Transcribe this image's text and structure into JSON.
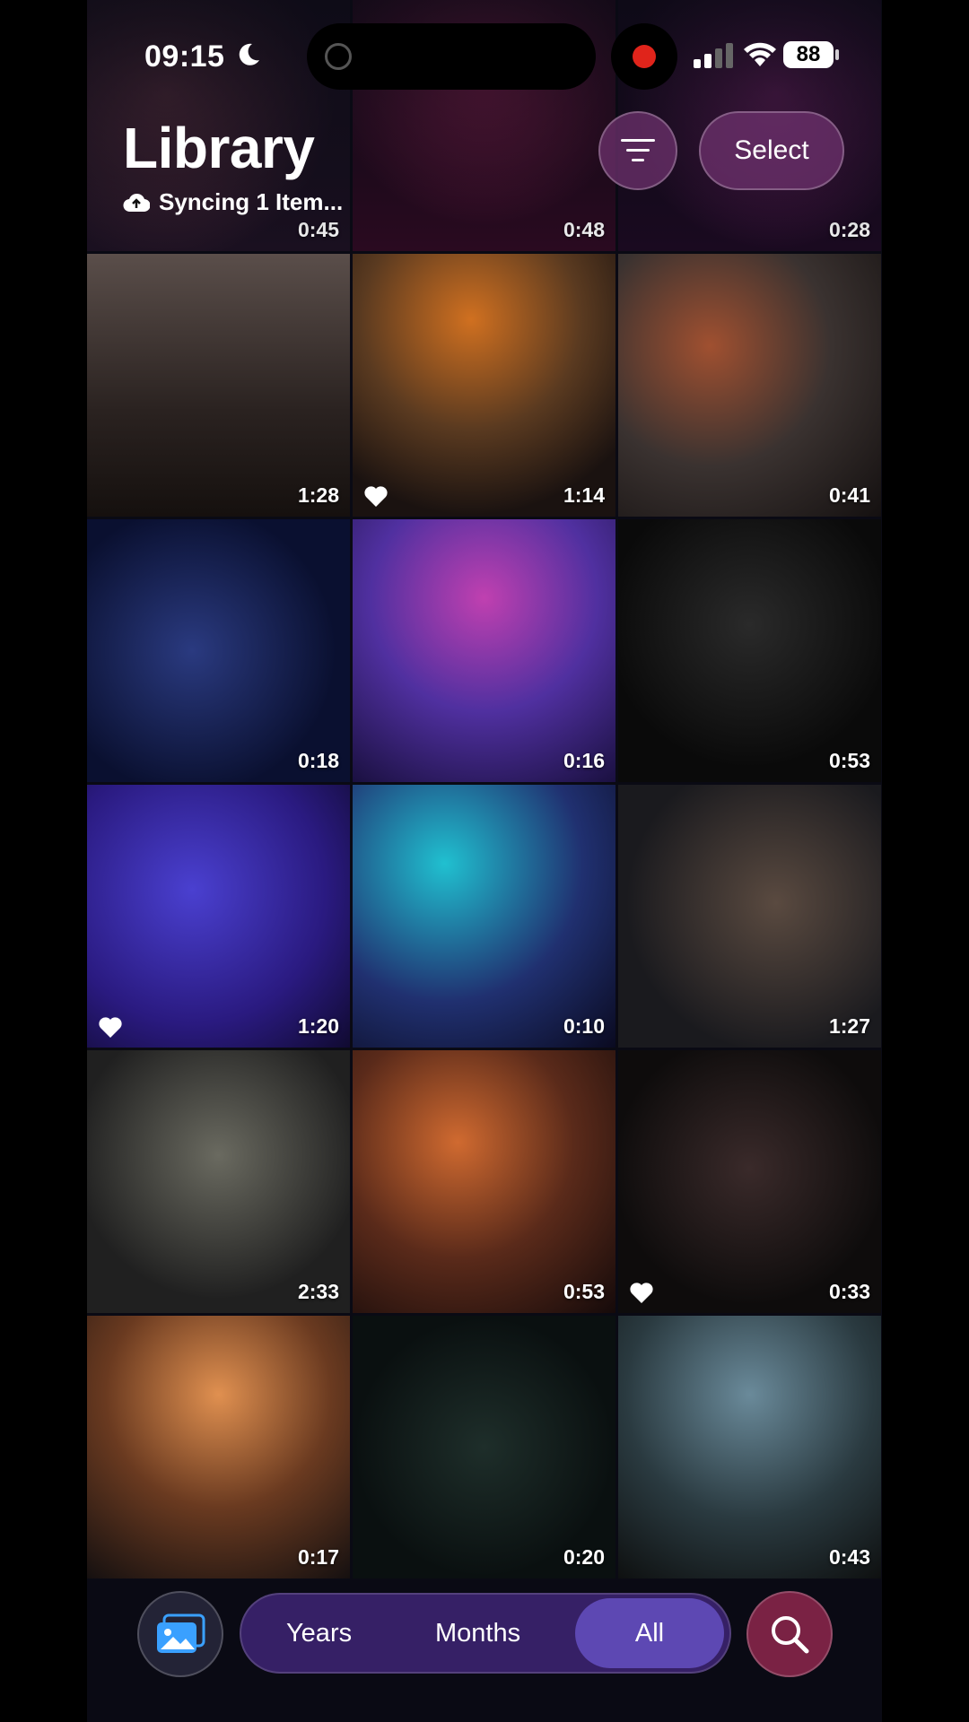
{
  "status_bar": {
    "time": "09:15",
    "battery": "88"
  },
  "header": {
    "title": "Library",
    "sync_status": "Syncing 1 Item...",
    "filter_icon": "filter-lines-icon",
    "select_label": "Select"
  },
  "grid": {
    "rows": [
      [
        {
          "duration": "0:45",
          "favorite": false
        },
        {
          "duration": "0:48",
          "favorite": false
        },
        {
          "duration": "0:28",
          "favorite": false
        }
      ],
      [
        {
          "duration": "1:28",
          "favorite": false
        },
        {
          "duration": "1:14",
          "favorite": true
        },
        {
          "duration": "0:41",
          "favorite": false
        }
      ],
      [
        {
          "duration": "0:18",
          "favorite": false
        },
        {
          "duration": "0:16",
          "favorite": false
        },
        {
          "duration": "0:53",
          "favorite": false
        }
      ],
      [
        {
          "duration": "1:20",
          "favorite": true
        },
        {
          "duration": "0:10",
          "favorite": false
        },
        {
          "duration": "1:27",
          "favorite": false
        }
      ],
      [
        {
          "duration": "2:33",
          "favorite": false
        },
        {
          "duration": "0:53",
          "favorite": false
        },
        {
          "duration": "0:33",
          "favorite": true
        }
      ],
      [
        {
          "duration": "0:17",
          "favorite": false
        },
        {
          "duration": "0:20",
          "favorite": false
        },
        {
          "duration": "0:43",
          "favorite": false
        }
      ]
    ]
  },
  "bottom_bar": {
    "photos_icon": "photo-library-icon",
    "tabs": [
      "Years",
      "Months",
      "All"
    ],
    "selected_tab": "All",
    "search_icon": "search-icon"
  }
}
